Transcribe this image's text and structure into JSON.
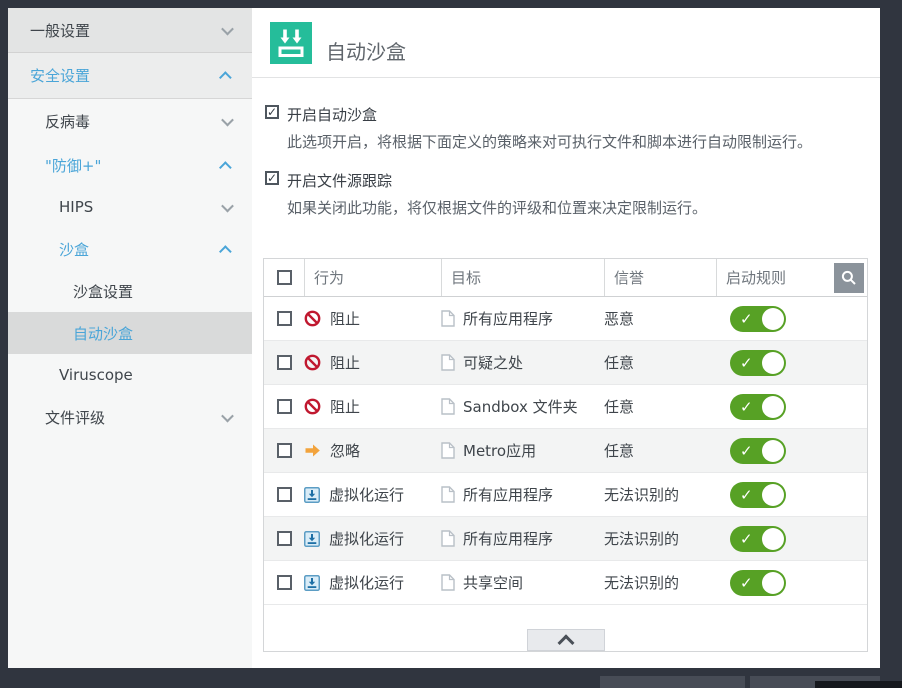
{
  "colors": {
    "accent_blue": "#4aa5d8",
    "brand_green": "#25bd9a",
    "toggle_green": "#57a125",
    "block_red": "#c0182f",
    "ignore_orange": "#f2a33c",
    "frame_dark": "#30353f",
    "selected_item_bg": "#d9dada"
  },
  "sidebar": {
    "items": [
      {
        "label": "一般设置",
        "level": 1,
        "chevron": "down",
        "expanded": false
      },
      {
        "label": "安全设置",
        "level": 1,
        "chevron": "up",
        "expanded": true
      },
      {
        "label": "反病毒",
        "level": 2,
        "chevron": "down",
        "expanded": false
      },
      {
        "label": "\"防御+\"",
        "level": 2,
        "chevron": "up",
        "expanded": true
      },
      {
        "label": "HIPS",
        "level": 3,
        "chevron": "down",
        "expanded": false
      },
      {
        "label": "沙盒",
        "level": 3,
        "chevron": "up",
        "expanded": true
      },
      {
        "label": "沙盒设置",
        "level": 4
      },
      {
        "label": "自动沙盒",
        "level": 4,
        "selected": true
      },
      {
        "label": "Viruscope",
        "level": 3
      },
      {
        "label": "文件评级",
        "level": 2,
        "chevron": "down",
        "expanded": false
      }
    ]
  },
  "header": {
    "title": "自动沙盒",
    "icon": "sandbox-icon"
  },
  "options": [
    {
      "checked": true,
      "label": "开启自动沙盒",
      "description": "此选项开启，将根据下面定义的策略来对可执行文件和脚本进行自动限制运行。"
    },
    {
      "checked": true,
      "label": "开启文件源跟踪",
      "description": "如果关闭此功能，将仅根据文件的评级和位置来决定限制运行。"
    }
  ],
  "table": {
    "headers": {
      "action": "行为",
      "target": "目标",
      "reputation": "信誉",
      "rule": "启动规则"
    },
    "header_icons": [
      "checkbox",
      "search-icon"
    ],
    "rows": [
      {
        "action": "阻止",
        "action_icon": "block-icon",
        "target": "所有应用程序",
        "reputation": "恶意",
        "enabled": true
      },
      {
        "action": "阻止",
        "action_icon": "block-icon",
        "target": "可疑之处",
        "reputation": "任意",
        "enabled": true
      },
      {
        "action": "阻止",
        "action_icon": "block-icon",
        "target": "Sandbox 文件夹",
        "reputation": "任意",
        "enabled": true
      },
      {
        "action": "忽略",
        "action_icon": "ignore-icon",
        "target": "Metro应用",
        "reputation": "任意",
        "enabled": true
      },
      {
        "action": "虚拟化运行",
        "action_icon": "virtualize-icon",
        "target": "所有应用程序",
        "reputation": "无法识别的",
        "enabled": true
      },
      {
        "action": "虚拟化运行",
        "action_icon": "virtualize-icon",
        "target": "所有应用程序",
        "reputation": "无法识别的",
        "enabled": true
      },
      {
        "action": "虚拟化运行",
        "action_icon": "virtualize-icon",
        "target": "共享空间",
        "reputation": "无法识别的",
        "enabled": true
      }
    ],
    "footer_icon": "chevron-up-icon",
    "toggle_check_glyph": "✓"
  },
  "checkbox_glyph": "✓"
}
